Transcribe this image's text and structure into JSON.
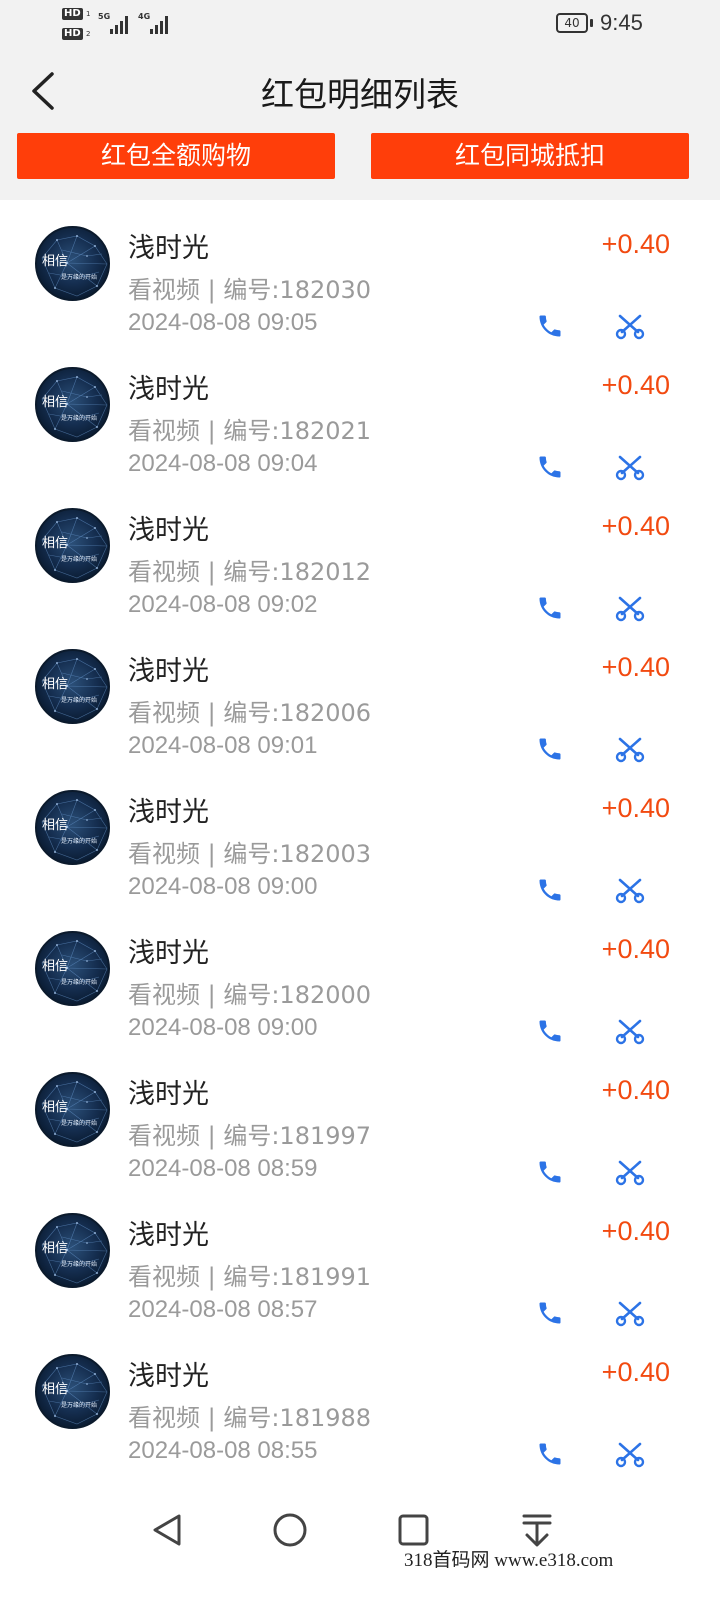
{
  "status_bar": {
    "time": "9:45",
    "battery": "40",
    "network_1": "5G",
    "network_2": "4G",
    "hd_1": "HD",
    "hd_2": "HD",
    "sim_1": "1",
    "sim_2": "2"
  },
  "header": {
    "title": "红包明细列表",
    "back_icon": "chevron-left-icon"
  },
  "buttons": {
    "left": "红包全额购物",
    "right": "红包同城抵扣"
  },
  "colors": {
    "accent": "#ff3e0a",
    "amount": "#f24a10",
    "icon_blue": "#2c73e6"
  },
  "avatar": {
    "title": "相信",
    "subtitle": "是万缘的开始"
  },
  "items": [
    {
      "name": "浅时光",
      "desc": "看视频 | 编号:182030",
      "date": "2024-08-08 09:05",
      "amount": "+0.40"
    },
    {
      "name": "浅时光",
      "desc": "看视频 | 编号:182021",
      "date": "2024-08-08 09:04",
      "amount": "+0.40"
    },
    {
      "name": "浅时光",
      "desc": "看视频 | 编号:182012",
      "date": "2024-08-08 09:02",
      "amount": "+0.40"
    },
    {
      "name": "浅时光",
      "desc": "看视频 | 编号:182006",
      "date": "2024-08-08 09:01",
      "amount": "+0.40"
    },
    {
      "name": "浅时光",
      "desc": "看视频 | 编号:182003",
      "date": "2024-08-08 09:00",
      "amount": "+0.40"
    },
    {
      "name": "浅时光",
      "desc": "看视频 | 编号:182000",
      "date": "2024-08-08 09:00",
      "amount": "+0.40"
    },
    {
      "name": "浅时光",
      "desc": "看视频 | 编号:181997",
      "date": "2024-08-08 08:59",
      "amount": "+0.40"
    },
    {
      "name": "浅时光",
      "desc": "看视频 | 编号:181991",
      "date": "2024-08-08 08:57",
      "amount": "+0.40"
    },
    {
      "name": "浅时光",
      "desc": "看视频 | 编号:181988",
      "date": "2024-08-08 08:55",
      "amount": "+0.40"
    }
  ],
  "nav": {
    "icons": [
      "back-triangle-icon",
      "home-circle-icon",
      "recent-square-icon",
      "download-icon"
    ]
  },
  "watermark": "318首码网   www.e318.com"
}
